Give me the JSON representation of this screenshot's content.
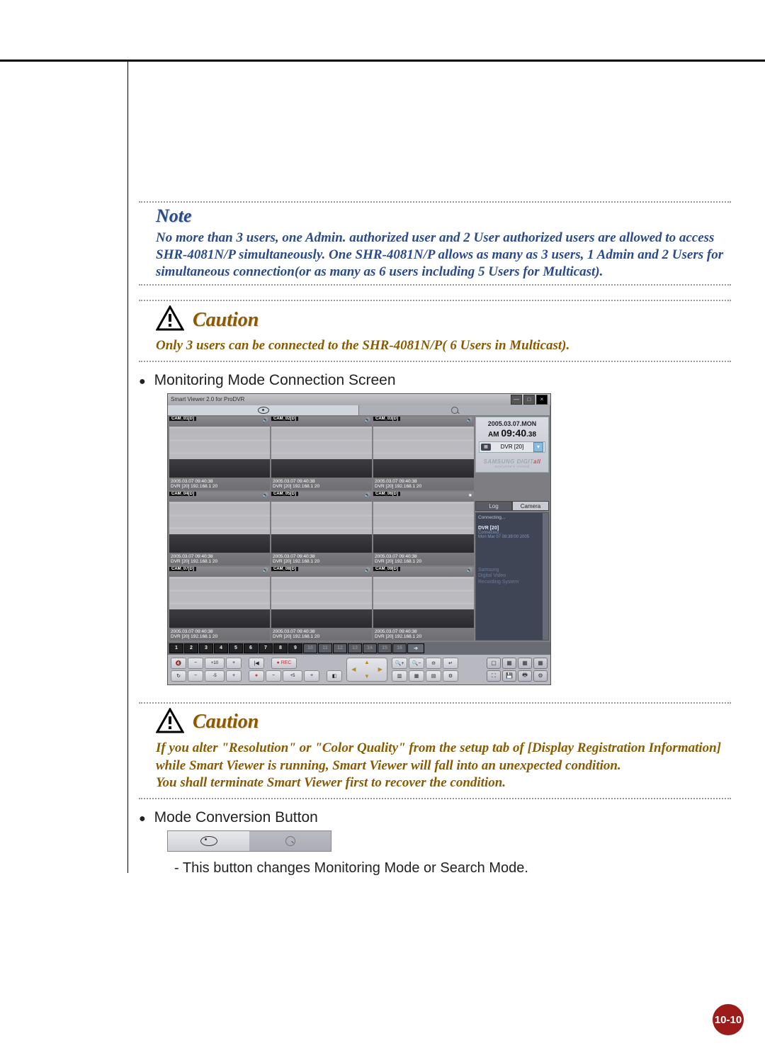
{
  "note": {
    "title": "Note",
    "body": "No more than 3 users, one Admin. authorized user and 2 User authorized users are allowed to access SHR-4081N/P simultaneously. One SHR-4081N/P allows as many as 3 users, 1 Admin and 2 Users for simultaneous connection(or as many as 6 users including 5 Users for Multicast)."
  },
  "caution1": {
    "title": "Caution",
    "body": "Only 3 users can be connected to the SHR-4081N/P( 6 Users in Multicast)."
  },
  "bullet1": "Monitoring Mode Connection Screen",
  "sv": {
    "window_title": "Smart Viewer 2.0 for ProDVR",
    "date": "2005.03.07.MON",
    "time_prefix": "AM ",
    "time_main": "09:40",
    "time_sec": ".38",
    "dvr_selected": "DVR [20]",
    "brand": "SAMSUNG DIGIT",
    "brand_i": "all",
    "brand_sub": "everyone's invited",
    "tabs": {
      "log": "Log",
      "camera": "Camera"
    },
    "log": {
      "connecting": "Connecting...",
      "hdr": "DVR [20]",
      "sub1": "Connected...",
      "sub2": "Mon Mar 07 09:39:00 2005",
      "note1": "Samsung",
      "note2": "Digital Video",
      "note3": "Recording System"
    },
    "cams": [
      {
        "label": "CAM_01[D]",
        "ts1": "2005.03.07 09:40:38",
        "ts2": "DVR [20] 192.168.1 20",
        "aud": "🔊"
      },
      {
        "label": "CAM_02[D]",
        "ts1": "2005.03.07 09:40:38",
        "ts2": "DVR [20] 192.168.1 20",
        "aud": "🔊"
      },
      {
        "label": "CAM_03[D]",
        "ts1": "2005.03.07 09:40:38",
        "ts2": "DVR [20] 192.168.1 20",
        "aud": "🔊"
      },
      {
        "label": "CAM_04[D]",
        "ts1": "2005.03.07 09:40:38",
        "ts2": "DVR [20] 192.168.1 20",
        "aud": "🔊"
      },
      {
        "label": "CAM_05[D]",
        "ts1": "2005.03.07 09:40:38",
        "ts2": "DVR [20] 192.168.1 20",
        "aud": "🔊"
      },
      {
        "label": "CAM_06[D]",
        "ts1": "2005.03.07 09:40:38",
        "ts2": "DVR [20] 192.168.1 20",
        "aud": "★"
      },
      {
        "label": "CAM_07[D]",
        "ts1": "2005.03.07 09:40:38",
        "ts2": "DVR [20] 192.168.1 20",
        "aud": "🔊"
      },
      {
        "label": "CAM_08[D]",
        "ts1": "2005.03.07 09:40:38",
        "ts2": "DVR [20] 192.168.1 20",
        "aud": "🔊"
      },
      {
        "label": "CAM_09[D]",
        "ts1": "2005.03.07 09:40:38",
        "ts2": "DVR [20] 192.168.1 20",
        "aud": "🔊"
      }
    ],
    "channels": [
      "1",
      "2",
      "3",
      "4",
      "5",
      "6",
      "7",
      "8",
      "9",
      "10",
      "11",
      "12",
      "13",
      "14",
      "15",
      "16"
    ],
    "ctrl": {
      "vol_up": "+10",
      "vol_dn": "-5",
      "rec": "REC"
    }
  },
  "caution2": {
    "title": "Caution",
    "body": "If you alter \"Resolution\" or \"Color Quality\" from the setup tab of [Display Registration Information] while Smart Viewer is running, Smart Viewer will fall into an unexpected condition.\nYou shall terminate Smart Viewer first to recover the condition."
  },
  "bullet2": "Mode Conversion Button",
  "dash1": "- This button changes Monitoring Mode or Search Mode.",
  "page_badge": "10-10"
}
